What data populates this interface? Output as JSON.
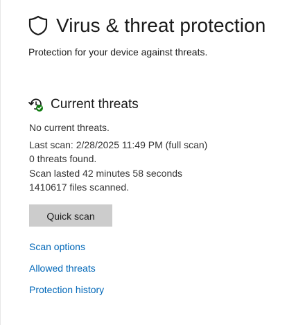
{
  "header": {
    "icon": "shield-icon",
    "title": "Virus & threat protection",
    "subtitle": "Protection for your device against threats."
  },
  "current_threats": {
    "icon": "scan-refresh-icon",
    "title": "Current threats",
    "status": "No current threats.",
    "last_scan": "Last scan: 2/28/2025 11:49 PM (full scan)",
    "threats_found": "0 threats found.",
    "duration": "Scan lasted 42 minutes 58 seconds",
    "files_scanned": "1410617 files scanned.",
    "quick_scan_label": "Quick scan"
  },
  "links": {
    "scan_options": "Scan options",
    "allowed_threats": "Allowed threats",
    "protection_history": "Protection history"
  },
  "colors": {
    "link": "#0067b8",
    "button_bg": "#cccccc",
    "ok_green": "#107c10"
  }
}
